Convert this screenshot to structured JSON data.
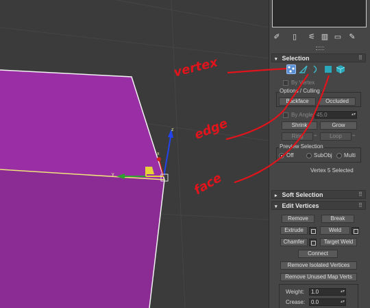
{
  "viewport": {
    "gizmo_labels": {
      "x": "x",
      "y": "y",
      "z": "z"
    }
  },
  "annotations": {
    "vertex": "vertex",
    "edge": "edge",
    "face": "face"
  },
  "colors": {
    "mesh": "#9a2fa5",
    "annotation": "#e1141c",
    "panel_bg": "#464646",
    "selected_mode": "#5b8fd1"
  },
  "toolbar": {
    "icons": [
      "pin-icon",
      "modifier-stack-icon",
      "show-end-result-icon",
      "make-unique-icon",
      "remove-modifier-icon",
      "configure-modifier-sets-icon"
    ]
  },
  "selection": {
    "title": "Selection",
    "modes": [
      "vertex",
      "edge",
      "border",
      "polygon",
      "element"
    ],
    "by_vertex": "By Vertex",
    "ignore_culling_label": "Options / Culling",
    "backface": "Backface",
    "occluded": "Occluded",
    "by_angle": "By Angle:",
    "by_angle_value": "45.0",
    "shrink": "Shrink",
    "grow": "Grow",
    "ring": "Ring",
    "loop": "Loop",
    "preview_title": "Preview Selection",
    "preview_options": [
      "Off",
      "SubObj",
      "Multi"
    ],
    "status": "Vertex 5 Selected"
  },
  "soft_selection": {
    "title": "Soft Selection"
  },
  "edit_vertices": {
    "title": "Edit Vertices",
    "remove": "Remove",
    "break": "Break",
    "extrude": "Extrude",
    "weld": "Weld",
    "chamfer": "Chamfer",
    "target_weld": "Target Weld",
    "connect": "Connect",
    "remove_isolated": "Remove Isolated Vertices",
    "remove_unused": "Remove Unused Map Verts",
    "weight_label": "Weight:",
    "weight_value": "1.0",
    "crease_label": "Crease:",
    "crease_value": "0.0"
  }
}
